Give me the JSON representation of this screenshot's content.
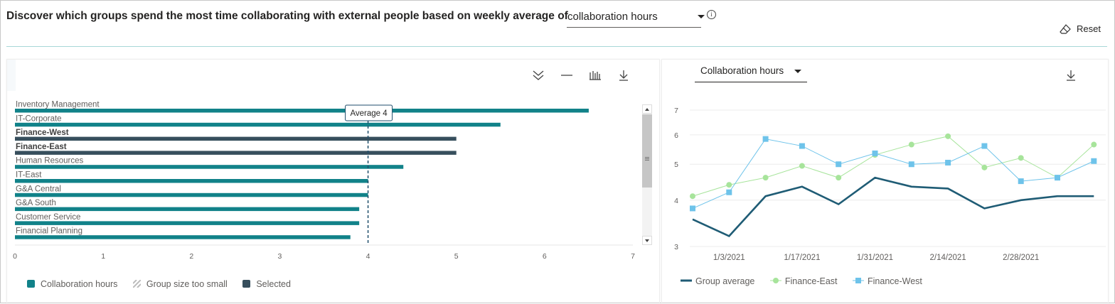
{
  "header": {
    "title": "Discover which groups spend the most time collaborating with external people based on weekly average of",
    "metric_value": "collaboration hours",
    "info_icon": "i",
    "reset_label": "Reset"
  },
  "left_panel": {
    "toolbar_icons": [
      "expand-all-icon",
      "collapse-icon",
      "chart-type-icon",
      "download-icon"
    ],
    "average_label": "Average 4",
    "legend": {
      "collaboration_hours": "Collaboration hours",
      "group_size_too_small": "Group size too small",
      "selected": "Selected"
    }
  },
  "right_panel": {
    "dropdown_value": "Collaboration hours",
    "toolbar_icons": [
      "download-icon"
    ],
    "legend": {
      "group_average": "Group average",
      "finance_east": "Finance-East",
      "finance_west": "Finance-West"
    }
  },
  "colors": {
    "teal": "#118289",
    "selected": "#374f5d",
    "dark_line": "#1f5c75",
    "green": "#a7e49b",
    "blue": "#6ec3ea"
  },
  "chart_data": [
    {
      "type": "bar",
      "orientation": "horizontal",
      "categories": [
        "Inventory Management",
        "IT-Corporate",
        "Finance-West",
        "Finance-East",
        "Human Resources",
        "IT-East",
        "G&A Central",
        "G&A South",
        "Customer Service",
        "Financial Planning"
      ],
      "values": [
        6.5,
        5.5,
        5.0,
        5.0,
        4.4,
        4.0,
        4.0,
        3.9,
        3.9,
        3.8
      ],
      "selected": [
        false,
        false,
        true,
        true,
        false,
        false,
        false,
        false,
        false,
        false
      ],
      "xlim": [
        0,
        7
      ],
      "xticks": [
        "0",
        "1",
        "2",
        "3",
        "4",
        "5",
        "6",
        "7"
      ],
      "average": 4,
      "legend": [
        "Collaboration hours",
        "Group size too small",
        "Selected"
      ]
    },
    {
      "type": "line",
      "x": [
        "12/27/2020",
        "1/3/2021",
        "1/10/2021",
        "1/17/2021",
        "1/24/2021",
        "1/31/2021",
        "2/7/2021",
        "2/14/2021",
        "2/21/2021",
        "2/28/2021",
        "3/7/2021",
        "3/14/2021"
      ],
      "xticks": [
        "1/3/2021",
        "1/17/2021",
        "1/31/2021",
        "2/14/2021",
        "2/28/2021"
      ],
      "yticks": [
        "3",
        "4",
        "5",
        "6",
        "7"
      ],
      "ylim": [
        3,
        7
      ],
      "y_scale": "log",
      "series": [
        {
          "name": "Group average",
          "values": [
            3.55,
            3.2,
            4.1,
            4.35,
            3.9,
            4.6,
            4.35,
            4.3,
            3.8,
            4.0,
            4.1,
            4.1
          ]
        },
        {
          "name": "Finance-East",
          "values": [
            4.1,
            4.4,
            4.6,
            4.95,
            4.6,
            5.3,
            5.65,
            5.95,
            4.9,
            5.2,
            4.6,
            5.65
          ]
        },
        {
          "name": "Finance-West",
          "values": [
            3.8,
            4.2,
            5.85,
            5.6,
            5.0,
            5.35,
            5.0,
            5.05,
            5.6,
            4.5,
            4.6,
            5.1
          ]
        }
      ],
      "legend": [
        "Group average",
        "Finance-East",
        "Finance-West"
      ]
    }
  ]
}
